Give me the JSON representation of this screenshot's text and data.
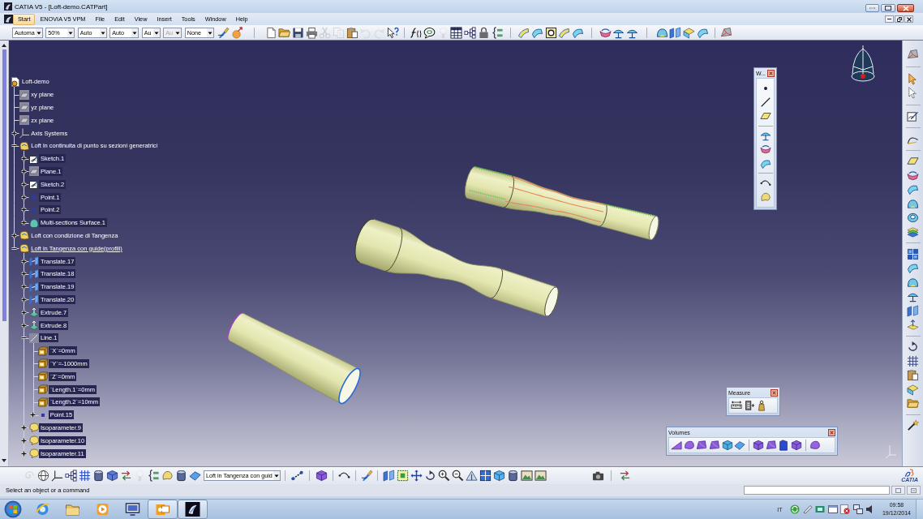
{
  "window": {
    "title": "CATIA V5 - [Loft-demo.CATPart]"
  },
  "menu_bar": {
    "items": [
      {
        "label": "Start",
        "selected": true
      },
      {
        "label": "ENOVIA V5 VPM",
        "selected": false
      },
      {
        "label": "File",
        "selected": false
      },
      {
        "label": "Edit",
        "selected": false
      },
      {
        "label": "View",
        "selected": false
      },
      {
        "label": "Insert",
        "selected": false
      },
      {
        "label": "Tools",
        "selected": false
      },
      {
        "label": "Window",
        "selected": false
      },
      {
        "label": "Help",
        "selected": false
      }
    ]
  },
  "toolbar": {
    "dropdowns": [
      {
        "value": "Automa",
        "disabled": false
      },
      {
        "value": "50%",
        "disabled": false
      },
      {
        "value": "Auto",
        "disabled": false
      },
      {
        "value": "Auto",
        "disabled": false
      },
      {
        "value": "Au",
        "disabled": false
      },
      {
        "value": "Au",
        "disabled": true
      },
      {
        "value": "None",
        "disabled": false
      }
    ],
    "buttons": [
      {
        "disabled": false
      },
      {
        "disabled": false
      },
      {
        "disabled": false
      },
      {
        "disabled": false
      },
      {
        "disabled": false
      },
      {
        "disabled": false
      },
      {
        "disabled": true
      },
      {
        "disabled": true
      },
      {
        "disabled": false
      },
      {
        "disabled": true
      },
      {
        "disabled": true
      },
      {
        "disabled": false
      },
      {
        "disabled": false
      },
      {
        "disabled": false
      },
      {
        "disabled": true
      },
      {
        "disabled": false
      },
      {
        "disabled": false
      },
      {
        "disabled": false
      },
      {
        "disabled": false
      },
      {
        "disabled": false
      },
      {
        "disabled": false
      },
      {
        "disabled": false
      },
      {
        "disabled": false
      },
      {
        "disabled": false
      },
      {
        "disabled": false
      },
      {
        "disabled": false
      },
      {
        "disabled": false
      },
      {
        "disabled": false
      },
      {
        "disabled": false
      },
      {
        "disabled": false
      },
      {
        "disabled": false
      },
      {
        "disabled": false
      }
    ]
  },
  "specification_tree": [
    {
      "label": "Loft-demo",
      "kind": "part",
      "highlighted": false,
      "underlined": false,
      "children": [
        {
          "label": "xy plane",
          "kind": "plane",
          "highlighted": false,
          "underlined": false
        },
        {
          "label": "yz plane",
          "kind": "plane",
          "highlighted": false,
          "underlined": false
        },
        {
          "label": "zx plane",
          "kind": "plane",
          "highlighted": false,
          "underlined": false
        },
        {
          "label": "Axis Systems",
          "kind": "axis_system",
          "expanded": false,
          "highlighted": false,
          "underlined": false
        },
        {
          "label": "Loft in continuita di punto su sezioni generatrici",
          "kind": "geometrical_set",
          "expanded": true,
          "highlighted": false,
          "underlined": false,
          "children": [
            {
              "label": "Sketch.1",
              "kind": "sketch",
              "expanded": false,
              "highlighted": true,
              "underlined": false
            },
            {
              "label": "Plane.1",
              "kind": "plane",
              "expanded": false,
              "highlighted": true,
              "underlined": false
            },
            {
              "label": "Sketch.2",
              "kind": "sketch",
              "expanded": false,
              "highlighted": true,
              "underlined": false
            },
            {
              "label": "Point.1",
              "kind": "point",
              "expanded": false,
              "highlighted": true,
              "underlined": false
            },
            {
              "label": "Point.2",
              "kind": "point",
              "expanded": false,
              "highlighted": true,
              "underlined": false
            },
            {
              "label": "Multi-sections Surface.1",
              "kind": "surface",
              "expanded": false,
              "highlighted": true,
              "underlined": false
            }
          ]
        },
        {
          "label": "Loft con condizione di Tangenza",
          "kind": "geometrical_set",
          "expanded": false,
          "highlighted": false,
          "underlined": false
        },
        {
          "label": "Loft in Tangenza con guide(profili)",
          "kind": "geometrical_set",
          "expanded": true,
          "highlighted": false,
          "underlined": true,
          "children": [
            {
              "label": "Translate.17",
              "kind": "translate",
              "expanded": false,
              "highlighted": true,
              "underlined": false
            },
            {
              "label": "Translate.18",
              "kind": "translate",
              "expanded": false,
              "highlighted": true,
              "underlined": false
            },
            {
              "label": "Translate.19",
              "kind": "translate",
              "expanded": false,
              "highlighted": true,
              "underlined": false
            },
            {
              "label": "Translate.20",
              "kind": "translate",
              "expanded": false,
              "highlighted": true,
              "underlined": false
            },
            {
              "label": "Extrude.7",
              "kind": "extrude",
              "expanded": false,
              "highlighted": true,
              "underlined": false
            },
            {
              "label": "Extrude.8",
              "kind": "extrude",
              "expanded": false,
              "highlighted": true,
              "underlined": false
            },
            {
              "label": "Line.1",
              "kind": "line",
              "expanded": true,
              "highlighted": true,
              "underlined": false,
              "children": [
                {
                  "label": "`X`=0mm",
                  "kind": "parameter",
                  "highlighted": true,
                  "underlined": false
                },
                {
                  "label": "`Y`=-1000mm",
                  "kind": "parameter",
                  "highlighted": true,
                  "underlined": false
                },
                {
                  "label": "`Z`=0mm",
                  "kind": "parameter",
                  "highlighted": true,
                  "underlined": false
                },
                {
                  "label": "`Length.1`=0mm",
                  "kind": "parameter",
                  "highlighted": true,
                  "underlined": false
                },
                {
                  "label": "`Length.2`=10mm",
                  "kind": "parameter",
                  "highlighted": true,
                  "underlined": false
                },
                {
                  "label": "Point.15",
                  "kind": "point",
                  "expanded": false,
                  "highlighted": true,
                  "underlined": false
                }
              ]
            },
            {
              "label": "Isoparameter.9",
              "kind": "isoparameter",
              "expanded": false,
              "highlighted": true,
              "underlined": false
            },
            {
              "label": "Isoparameter.10",
              "kind": "isoparameter",
              "expanded": false,
              "highlighted": true,
              "underlined": false
            },
            {
              "label": "Isoparameter.11",
              "kind": "isoparameter",
              "expanded": false,
              "highlighted": true,
              "underlined": false
            }
          ]
        }
      ]
    }
  ],
  "floating_toolbars": [
    {
      "title": "W..."
    },
    {
      "title": "Measure"
    },
    {
      "title": "Volumes"
    }
  ],
  "bottom_toolbar": {
    "buttons": [
      {
        "disabled": true
      },
      {
        "disabled": false
      },
      {
        "disabled": false
      },
      {
        "disabled": false
      },
      {
        "disabled": false
      },
      {
        "disabled": false
      },
      {
        "disabled": false
      },
      {
        "disabled": false
      },
      {
        "disabled": true
      },
      {
        "disabled": false
      },
      {
        "disabled": false
      },
      {
        "disabled": false
      },
      {
        "disabled": false
      },
      {
        "disabled": false
      },
      {
        "disabled": false
      },
      {
        "disabled": false
      },
      {
        "disabled": false
      },
      {
        "disabled": false
      },
      {
        "disabled": false
      },
      {
        "disabled": false
      },
      {
        "disabled": false
      },
      {
        "disabled": false
      },
      {
        "disabled": false
      },
      {
        "disabled": false
      },
      {
        "disabled": false
      },
      {
        "disabled": false
      },
      {
        "disabled": false
      },
      {
        "disabled": false
      },
      {
        "disabled": false
      },
      {
        "disabled": false
      },
      {
        "disabled": false
      }
    ],
    "dropdown": {
      "value": "Loft in Tangenza con guid"
    },
    "logo_text": "CATIA"
  },
  "status_bar": {
    "message": "Select an object or a command"
  },
  "taskbar": {
    "buttons": [
      {
        "open": false
      },
      {
        "open": false
      },
      {
        "open": false
      },
      {
        "open": false
      },
      {
        "open": true
      },
      {
        "open": true
      }
    ],
    "tray": {
      "language": "IT",
      "time": "09:58",
      "date": "19/12/2014"
    }
  }
}
